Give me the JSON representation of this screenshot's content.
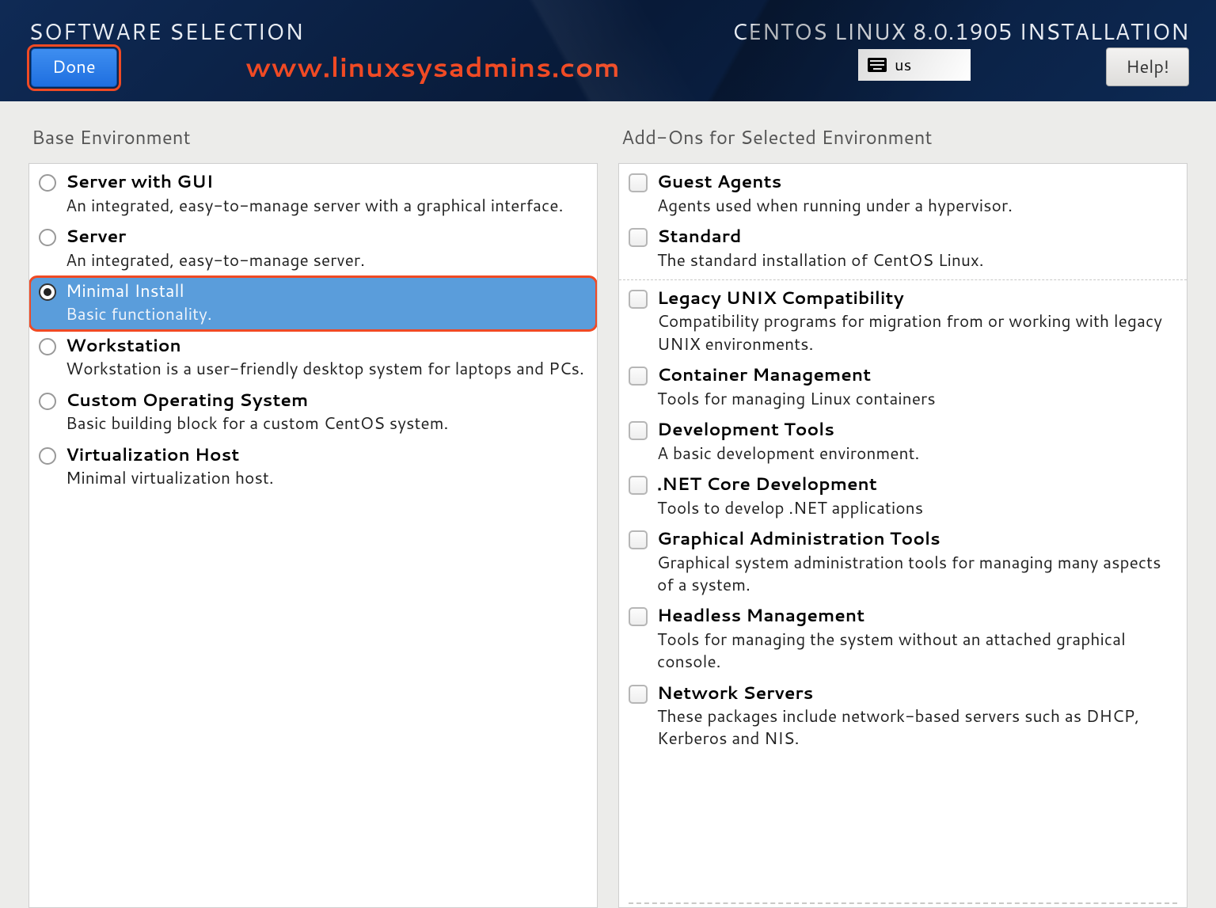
{
  "header": {
    "title": "SOFTWARE SELECTION",
    "installer_title": "CENTOS LINUX 8.0.1905 INSTALLATION",
    "done_label": "Done",
    "help_label": "Help!",
    "keyboard_layout": "us",
    "watermark": "www.linuxsysadmins.com"
  },
  "left": {
    "heading": "Base Environment",
    "options": [
      {
        "label": "Server with GUI",
        "desc": "An integrated, easy-to-manage server with a graphical interface.",
        "selected": false
      },
      {
        "label": "Server",
        "desc": "An integrated, easy-to-manage server.",
        "selected": false
      },
      {
        "label": "Minimal Install",
        "desc": "Basic functionality.",
        "selected": true
      },
      {
        "label": "Workstation",
        "desc": "Workstation is a user-friendly desktop system for laptops and PCs.",
        "selected": false
      },
      {
        "label": "Custom Operating System",
        "desc": "Basic building block for a custom CentOS system.",
        "selected": false
      },
      {
        "label": "Virtualization Host",
        "desc": "Minimal virtualization host.",
        "selected": false
      }
    ]
  },
  "right": {
    "heading": "Add-Ons for Selected Environment",
    "addons": [
      {
        "label": "Guest Agents",
        "desc": "Agents used when running under a hypervisor.",
        "sep": false
      },
      {
        "label": "Standard",
        "desc": "The standard installation of CentOS Linux.",
        "sep": false
      },
      {
        "label": "Legacy UNIX Compatibility",
        "desc": "Compatibility programs for migration from or working with legacy UNIX environments.",
        "sep": true
      },
      {
        "label": "Container Management",
        "desc": "Tools for managing Linux containers",
        "sep": false
      },
      {
        "label": "Development Tools",
        "desc": "A basic development environment.",
        "sep": false
      },
      {
        "label": ".NET Core Development",
        "desc": "Tools to develop .NET applications",
        "sep": false
      },
      {
        "label": "Graphical Administration Tools",
        "desc": "Graphical system administration tools for managing many aspects of a system.",
        "sep": false
      },
      {
        "label": "Headless Management",
        "desc": "Tools for managing the system without an attached graphical console.",
        "sep": false
      },
      {
        "label": "Network Servers",
        "desc": "These packages include network-based servers such as DHCP, Kerberos and NIS.",
        "sep": false
      }
    ]
  }
}
